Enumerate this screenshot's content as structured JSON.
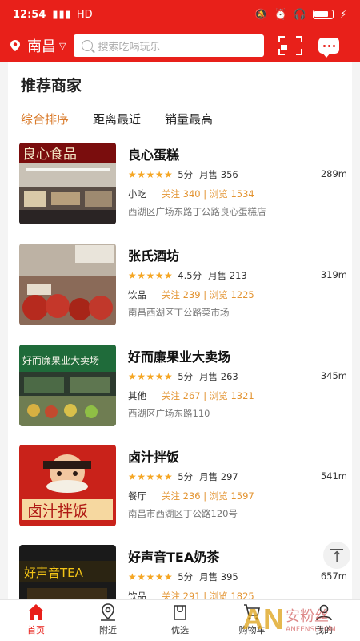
{
  "status": {
    "time": "12:54",
    "signal": "4G",
    "network": "HD"
  },
  "header": {
    "city": "南昌",
    "search_placeholder": "搜索吃喝玩乐"
  },
  "section": {
    "title": "推荐商家"
  },
  "sort_tabs": [
    "综合排序",
    "距离最近",
    "销量最高"
  ],
  "shops": [
    {
      "name": "良心蛋糕",
      "stars": "★★★★★",
      "score": "5分",
      "sales": "月售 356",
      "distance": "289m",
      "category": "小吃",
      "stats": "关注 340 | 浏览 1534",
      "address": "西湖区广场东路丁公路良心蛋糕店",
      "thumb_text": "良心食品"
    },
    {
      "name": "张氏酒坊",
      "stars": "★★★★★",
      "score": "4.5分",
      "sales": "月售 213",
      "distance": "319m",
      "category": "饮品",
      "stats": "关注 239 | 浏览 1225",
      "address": "南昌西湖区丁公路菜市场",
      "thumb_text": ""
    },
    {
      "name": "好而廉果业大卖场",
      "stars": "★★★★★",
      "score": "5分",
      "sales": "月售 263",
      "distance": "345m",
      "category": "其他",
      "stats": "关注 267 | 浏览 1321",
      "address": "西湖区广场东路110",
      "thumb_text": "好而廉果业大卖场"
    },
    {
      "name": "卤汁拌饭",
      "stars": "★★★★★",
      "score": "5分",
      "sales": "月售 297",
      "distance": "541m",
      "category": "餐厅",
      "stats": "关注 236 | 浏览 1597",
      "address": "南昌市西湖区丁公路120号",
      "thumb_text": "卤汁拌饭"
    },
    {
      "name": "好声音TEA奶茶",
      "stars": "★★★★★",
      "score": "5分",
      "sales": "月售 395",
      "distance": "657m",
      "category": "饮品",
      "stats": "关注 291 | 浏览 1825",
      "address": "",
      "thumb_text": "好声音TEA"
    }
  ],
  "tabbar": [
    {
      "label": "首页",
      "icon": "home-icon",
      "active": true
    },
    {
      "label": "附近",
      "icon": "location-icon",
      "active": false
    },
    {
      "label": "优选",
      "icon": "bag-icon",
      "active": false
    },
    {
      "label": "购物车",
      "icon": "cart-icon",
      "active": false
    },
    {
      "label": "我的",
      "icon": "user-icon",
      "active": false
    }
  ],
  "watermark": {
    "mark": "AN",
    "name": "安粉丝",
    "url": "ANFENSI.COM"
  },
  "colors": {
    "brand": "#e8201a",
    "accent": "#d97a2a",
    "star": "#f5a623"
  }
}
